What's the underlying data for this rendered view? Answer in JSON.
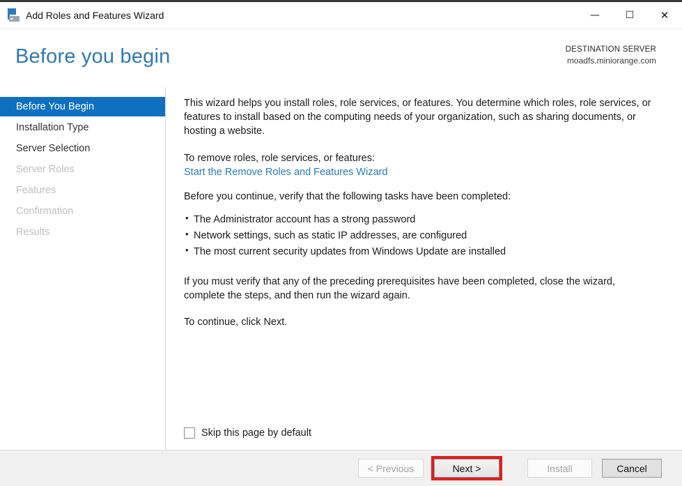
{
  "window": {
    "title": "Add Roles and Features Wizard",
    "controls": {
      "minimize": "—",
      "maximize": "☐",
      "close": "✕"
    }
  },
  "header": {
    "title": "Before you begin",
    "destination_label": "DESTINATION SERVER",
    "destination_server": "moadfs.miniorange.com"
  },
  "sidebar": {
    "items": [
      {
        "label": "Before You Begin",
        "state": "selected"
      },
      {
        "label": "Installation Type",
        "state": "enabled"
      },
      {
        "label": "Server Selection",
        "state": "enabled"
      },
      {
        "label": "Server Roles",
        "state": "disabled"
      },
      {
        "label": "Features",
        "state": "disabled"
      },
      {
        "label": "Confirmation",
        "state": "disabled"
      },
      {
        "label": "Results",
        "state": "disabled"
      }
    ]
  },
  "content": {
    "intro": "This wizard helps you install roles, role services, or features. You determine which roles, role services, or features to install based on the computing needs of your organization, such as sharing documents, or hosting a website.",
    "remove_label": "To remove roles, role services, or features:",
    "remove_link": "Start the Remove Roles and Features Wizard",
    "verify_label": "Before you continue, verify that the following tasks have been completed:",
    "tasks": [
      "The Administrator account has a strong password",
      "Network settings, such as static IP addresses, are configured",
      "The most current security updates from Windows Update are installed"
    ],
    "note": "If you must verify that any of the preceding prerequisites have been completed, close the wizard, complete the steps, and then run the wizard again.",
    "continue_hint": "To continue, click Next.",
    "skip_checkbox": {
      "label": "Skip this page by default",
      "checked": false
    }
  },
  "footer": {
    "previous_label": "< Previous",
    "next_label": "Next >",
    "install_label": "Install",
    "cancel_label": "Cancel",
    "next_highlighted": true
  },
  "colors": {
    "accent_blue": "#0e70c0",
    "heading_blue": "#3178ad",
    "link_blue": "#2b7bb0",
    "highlight_red": "#e01e1e"
  }
}
